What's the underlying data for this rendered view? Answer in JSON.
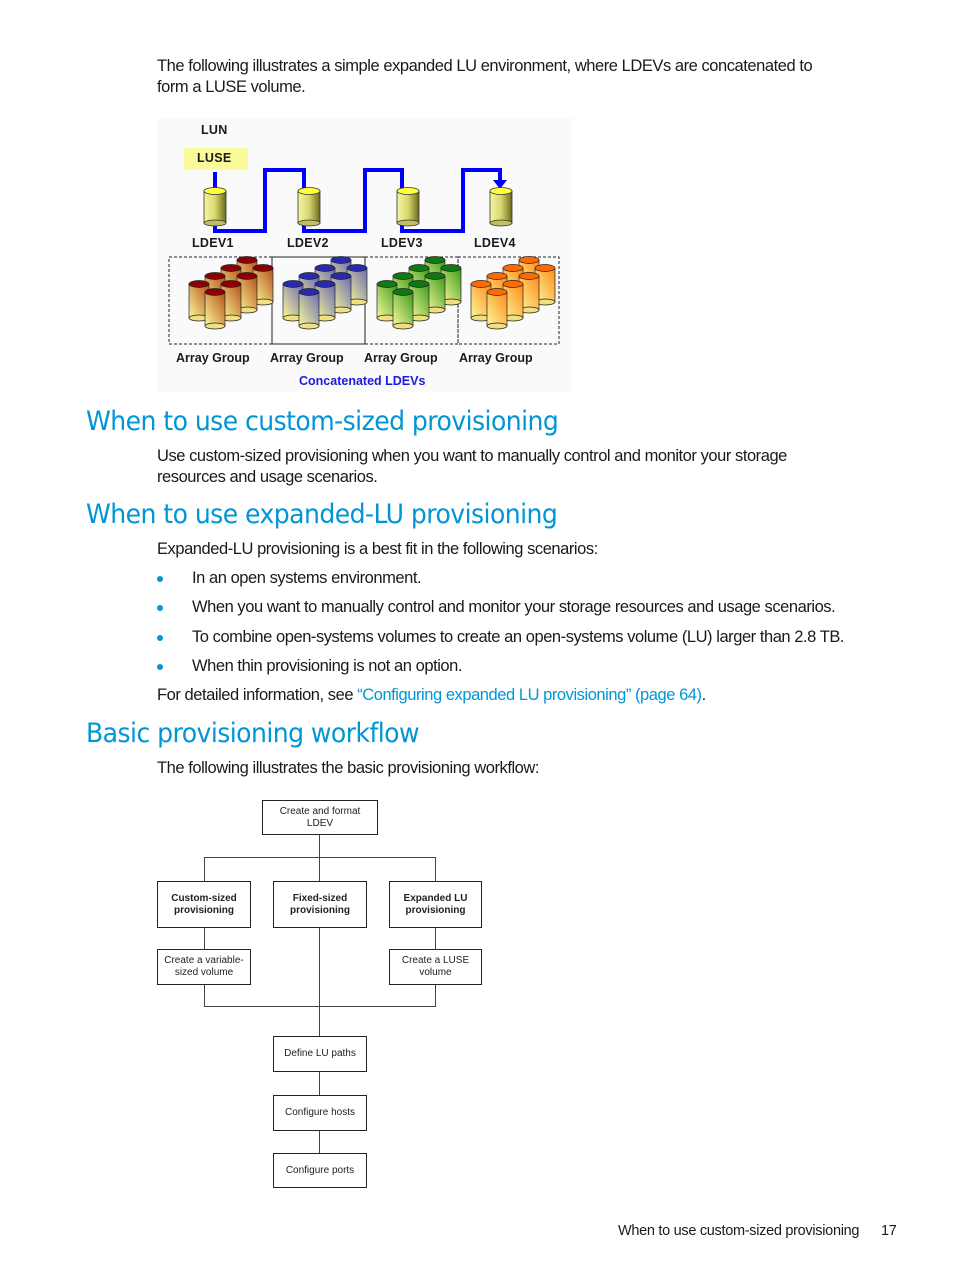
{
  "intro_paragraph": {
    "line1": "The following illustrates a simple expanded LU environment, where LDEVs are concatenated to",
    "line2": "form a LUSE volume."
  },
  "figure_luse": {
    "lun_label": "LUN",
    "luse_label": "LUSE",
    "ldevs": [
      "LDEV1",
      "LDEV2",
      "LDEV3",
      "LDEV4"
    ],
    "array_groups": [
      {
        "label": "Array Group",
        "top_color": "#8b0000",
        "body_color": "#c8722a"
      },
      {
        "label": "Array Group",
        "top_color": "#2a2ab0",
        "body_color": "#8888b8"
      },
      {
        "label": "Array Group",
        "top_color": "#0f7a0f",
        "body_color": "#4aa82a"
      },
      {
        "label": "Array Group",
        "top_color": "#ff6a00",
        "body_color": "#ff9a30"
      }
    ],
    "caption": "Concatenated LDEVs",
    "path_color": "#0000ff"
  },
  "sections": [
    {
      "heading": "When to use custom-sized provisioning",
      "paragraph": {
        "line1": "Use custom-sized provisioning when you want to manually control and monitor your storage",
        "line2": "resources and usage scenarios."
      }
    },
    {
      "heading": "When to use expanded-LU provisioning",
      "intro": "Expanded-LU provisioning is a best fit in the following scenarios:",
      "bullets": [
        "In an open systems environment.",
        "When you want to manually control and monitor your storage resources and usage scenarios.",
        "To combine open-systems volumes to create an open-systems volume (LU) larger than 2.8 TB.",
        "When thin provisioning is not an option."
      ],
      "see_also": {
        "prefix": "For detailed information, see ",
        "link_text": "“Configuring expanded LU provisioning” (page 64)",
        "suffix": "."
      }
    },
    {
      "heading": "Basic provisioning workflow",
      "intro": "The following illustrates the basic provisioning workflow:"
    }
  ],
  "workflow": {
    "top": {
      "line1": "Create and format",
      "line2": "LDEV"
    },
    "branches": [
      {
        "line1": "Custom-sized",
        "line2": "provisioning"
      },
      {
        "line1": "Fixed-sized",
        "line2": "provisioning"
      },
      {
        "line1": "Expanded LU",
        "line2": "provisioning"
      }
    ],
    "sub_steps": [
      {
        "line1": "Create a variable-",
        "line2": "sized volume"
      },
      {
        "line1": "Create a LUSE",
        "line2": "volume"
      }
    ],
    "final_steps": [
      "Define LU paths",
      "Configure hosts",
      "Configure ports"
    ]
  },
  "footer": {
    "section_title": "When to use custom-sized provisioning",
    "page_number": "17"
  },
  "colors": {
    "accent": "#0096d6",
    "text": "#1a1a1a"
  }
}
